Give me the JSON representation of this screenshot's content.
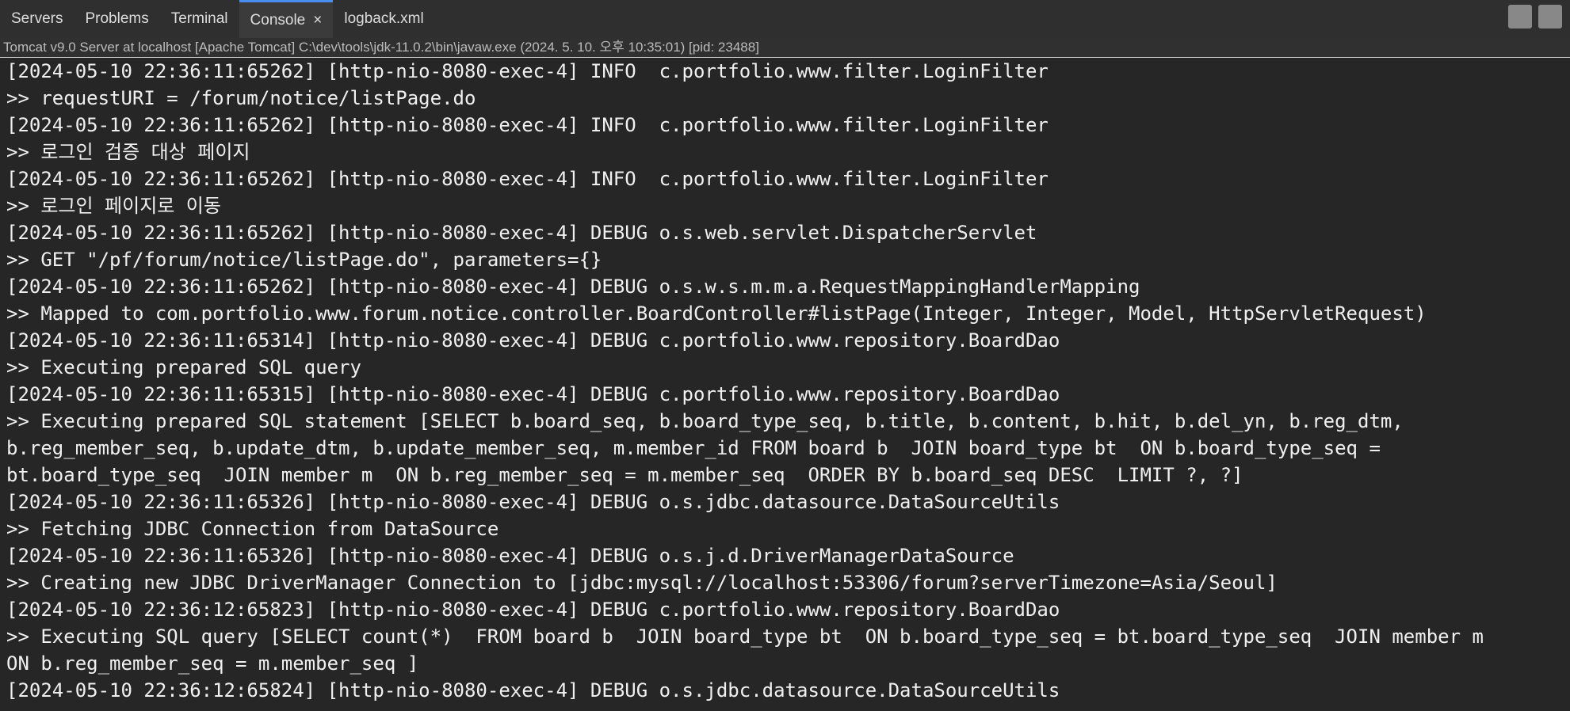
{
  "tabs": [
    {
      "label": "Servers"
    },
    {
      "label": "Problems"
    },
    {
      "label": "Terminal"
    },
    {
      "label": "Console"
    },
    {
      "label": "logback.xml"
    }
  ],
  "status": "Tomcat v9.0 Server at localhost [Apache Tomcat] C:\\dev\\tools\\jdk-11.0.2\\bin\\javaw.exe  (2024. 5. 10. 오후 10:35:01) [pid: 23488]",
  "lines": [
    "[2024-05-10 22:36:11:65262] [http-nio-8080-exec-4] INFO  c.portfolio.www.filter.LoginFilter",
    ">> requestURI = /forum/notice/listPage.do",
    "[2024-05-10 22:36:11:65262] [http-nio-8080-exec-4] INFO  c.portfolio.www.filter.LoginFilter",
    ">> 로그인 검증 대상 페이지",
    "[2024-05-10 22:36:11:65262] [http-nio-8080-exec-4] INFO  c.portfolio.www.filter.LoginFilter",
    ">> 로그인 페이지로 이동",
    "[2024-05-10 22:36:11:65262] [http-nio-8080-exec-4] DEBUG o.s.web.servlet.DispatcherServlet",
    ">> GET \"/pf/forum/notice/listPage.do\", parameters={}",
    "[2024-05-10 22:36:11:65262] [http-nio-8080-exec-4] DEBUG o.s.w.s.m.m.a.RequestMappingHandlerMapping",
    ">> Mapped to com.portfolio.www.forum.notice.controller.BoardController#listPage(Integer, Integer, Model, HttpServletRequest)",
    "[2024-05-10 22:36:11:65314] [http-nio-8080-exec-4] DEBUG c.portfolio.www.repository.BoardDao",
    ">> Executing prepared SQL query",
    "[2024-05-10 22:36:11:65315] [http-nio-8080-exec-4] DEBUG c.portfolio.www.repository.BoardDao",
    ">> Executing prepared SQL statement [SELECT b.board_seq, b.board_type_seq, b.title, b.content, b.hit, b.del_yn, b.reg_dtm,",
    "b.reg_member_seq, b.update_dtm, b.update_member_seq, m.member_id FROM board b  JOIN board_type bt  ON b.board_type_seq =",
    "bt.board_type_seq  JOIN member m  ON b.reg_member_seq = m.member_seq  ORDER BY b.board_seq DESC  LIMIT ?, ?]",
    "[2024-05-10 22:36:11:65326] [http-nio-8080-exec-4] DEBUG o.s.jdbc.datasource.DataSourceUtils",
    ">> Fetching JDBC Connection from DataSource",
    "[2024-05-10 22:36:11:65326] [http-nio-8080-exec-4] DEBUG o.s.j.d.DriverManagerDataSource",
    ">> Creating new JDBC DriverManager Connection to [jdbc:mysql://localhost:53306/forum?serverTimezone=Asia/Seoul]",
    "[2024-05-10 22:36:12:65823] [http-nio-8080-exec-4] DEBUG c.portfolio.www.repository.BoardDao",
    ">> Executing SQL query [SELECT count(*)  FROM board b  JOIN board_type bt  ON b.board_type_seq = bt.board_type_seq  JOIN member m",
    "ON b.reg_member_seq = m.member_seq ]",
    "[2024-05-10 22:36:12:65824] [http-nio-8080-exec-4] DEBUG o.s.jdbc.datasource.DataSourceUtils"
  ]
}
